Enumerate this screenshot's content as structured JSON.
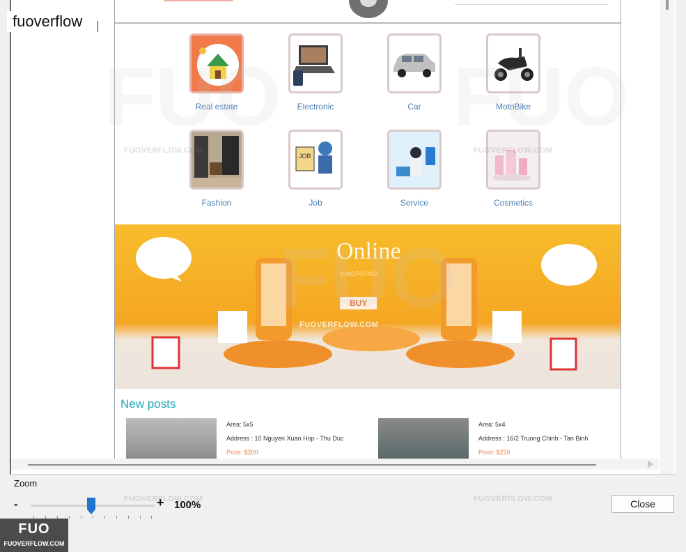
{
  "window": {
    "title_label": "fuoverflow"
  },
  "categories": [
    {
      "label": "Real estate",
      "icon": "house-icon"
    },
    {
      "label": "Electronic",
      "icon": "laptop-icon"
    },
    {
      "label": "Car",
      "icon": "car-icon"
    },
    {
      "label": "MotoBike",
      "icon": "motorbike-icon"
    },
    {
      "label": "Fashion",
      "icon": "fashion-store-icon"
    },
    {
      "label": "Job",
      "icon": "job-icon"
    },
    {
      "label": "Service",
      "icon": "service-icon"
    },
    {
      "label": "Cosmetics",
      "icon": "cosmetics-icon"
    }
  ],
  "banner": {
    "title": "Online",
    "subtitle": "SHOPPING",
    "button": "BUY"
  },
  "new_posts": {
    "heading": "New posts",
    "items": [
      {
        "area": "Area: 5x5",
        "address": "Address : 10 Nguyen Xuan Hop - Thu Duc",
        "price": "Price: $200"
      },
      {
        "area": "Area: 5x4",
        "address": "Address : 16/2 Truong Chinh - Tan Binh",
        "price": "Price: $220"
      }
    ]
  },
  "zoom": {
    "label": "Zoom",
    "minus": "-",
    "plus": "+",
    "value": "100%"
  },
  "buttons": {
    "close": "Close"
  },
  "watermark": {
    "text": "FUOVERFLOW.COM",
    "logo_mark": "FUO",
    "logo_text": "FUOVERFLOW.COM"
  },
  "colors": {
    "link": "#4a7db4",
    "heading": "#1fa6b5",
    "price": "#e8824a",
    "banner": "#f5a623"
  }
}
